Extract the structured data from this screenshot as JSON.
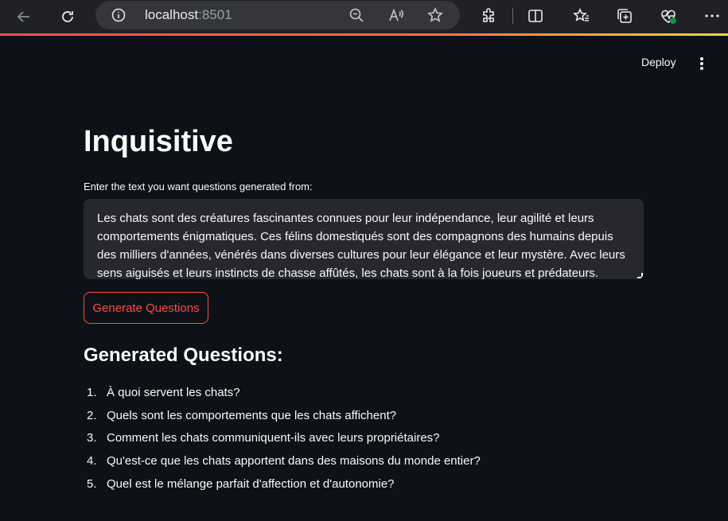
{
  "browser": {
    "url_host": "localhost",
    "url_port": ":8501",
    "icons": [
      "back-icon",
      "refresh-icon",
      "info-icon",
      "zoom-out-icon",
      "read-aloud-icon",
      "favorite-star-icon",
      "extensions-icon",
      "split-screen-icon",
      "favorites-icon",
      "collections-icon",
      "browser-essentials-icon",
      "more-icon"
    ]
  },
  "header": {
    "deploy_label": "Deploy"
  },
  "main": {
    "title": "Inquisitive",
    "input_label": "Enter the text you want questions generated from:",
    "input_value": "Les chats sont des créatures fascinantes connues pour leur indépendance, leur agilité et leurs comportements énigmatiques. Ces félins domestiqués sont des compagnons des humains depuis des milliers d'années, vénérés dans diverses cultures pour leur élégance et leur mystère. Avec leurs sens aiguisés et leurs instincts de chasse affûtés, les chats sont à la fois joueurs et prédateurs.",
    "button_label": "Generate Questions",
    "results_heading": "Generated Questions:",
    "questions": [
      {
        "num": "1.",
        "text": "À quoi servent les chats?"
      },
      {
        "num": "2.",
        "text": "Quels sont les comportements que les chats affichent?"
      },
      {
        "num": "3.",
        "text": "Comment les chats communiquent-ils avec leurs propriétaires?"
      },
      {
        "num": "4.",
        "text": "Qu'est-ce que les chats apportent dans des maisons du monde entier?"
      },
      {
        "num": "5.",
        "text": "Quel est le mélange parfait d'affection et d'autonomie?"
      }
    ]
  },
  "colors": {
    "background": "#0e1117",
    "accent": "#ff4b4b",
    "input_bg": "#262730"
  }
}
